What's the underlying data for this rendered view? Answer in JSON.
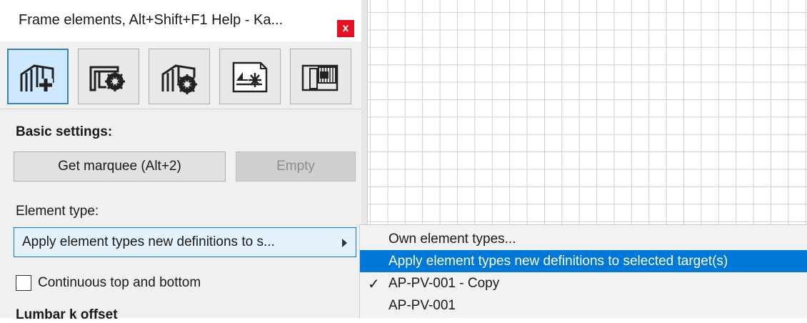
{
  "window": {
    "title": "Frame elements, Alt+Shift+F1 Help - Ka...",
    "close_glyph": "x"
  },
  "toolbar": {
    "tools": [
      {
        "name": "new-frame-element",
        "icon": "frame-add-icon",
        "active": true
      },
      {
        "name": "frame-settings",
        "icon": "frame-gear-icon",
        "active": false
      },
      {
        "name": "frame-element-settings",
        "icon": "frame-element-gear-icon",
        "active": false
      },
      {
        "name": "drawing-marker",
        "icon": "drawing-asterisk-icon",
        "active": false
      },
      {
        "name": "panel-view",
        "icon": "panel-view-icon",
        "active": false
      }
    ]
  },
  "basic_settings": {
    "label": "Basic settings:",
    "get_marquee_label": "Get marquee (Alt+2)",
    "empty_label": "Empty"
  },
  "element_type": {
    "label": "Element type:",
    "selected": "Apply element types new definitions to s..."
  },
  "continuous": {
    "label": "Continuous top and bottom",
    "checked": false
  },
  "partial_label": "Lumbar k offset",
  "menu": {
    "items": [
      {
        "label": "Own element types...",
        "checked": false,
        "highlighted": false
      },
      {
        "label": "Apply element types new definitions to selected target(s)",
        "checked": false,
        "highlighted": true
      },
      {
        "label": "AP-PV-001 - Copy",
        "checked": true,
        "highlighted": false
      },
      {
        "label": "AP-PV-001",
        "checked": false,
        "highlighted": false
      }
    ],
    "check_glyph": "✓"
  },
  "colors": {
    "accent": "#0078d7",
    "close": "#e81123",
    "active_tool": "#cde8ff"
  }
}
